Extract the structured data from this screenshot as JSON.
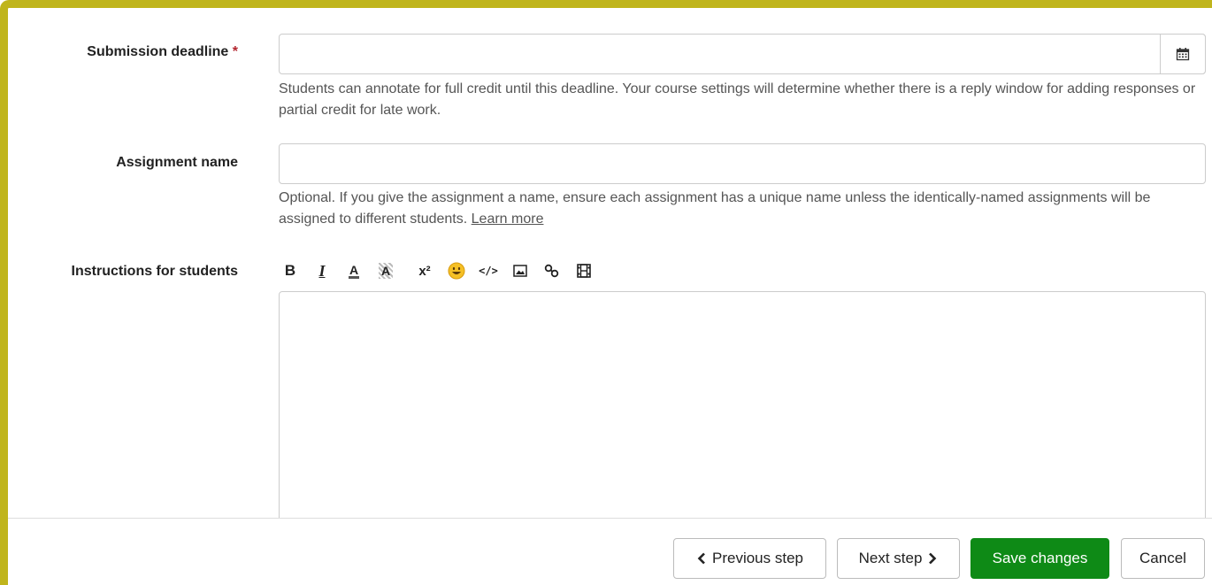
{
  "form": {
    "deadline": {
      "label": "Submission deadline",
      "required_marker": "*",
      "value": "",
      "placeholder": "",
      "calendar_icon": "calendar-icon",
      "help": "Students can annotate for full credit until this deadline. Your course settings will determine whether there is a reply window for adding responses or partial credit for late work."
    },
    "name": {
      "label": "Assignment name",
      "value": "",
      "placeholder": "",
      "help": "Optional. If you give the assignment a name, ensure each assignment has a unique name unless the identically-named assignments will be assigned to different students.",
      "learn_more": "Learn more"
    },
    "instructions": {
      "label": "Instructions for students",
      "toolbar": {
        "bold": "B",
        "italic": "I",
        "font_color": "A",
        "highlight": "A",
        "superscript": "x²",
        "emoji": "😀",
        "code": "</>",
        "image_icon": "image-icon",
        "link_icon": "link-icon",
        "video_icon": "film-icon"
      },
      "value": ""
    }
  },
  "footer": {
    "previous": "Previous step",
    "next": "Next step",
    "save": "Save changes",
    "cancel": "Cancel"
  },
  "colors": {
    "frame_accent": "#c0b51c",
    "primary_button": "#0e8a16",
    "required": "#b3262f"
  }
}
